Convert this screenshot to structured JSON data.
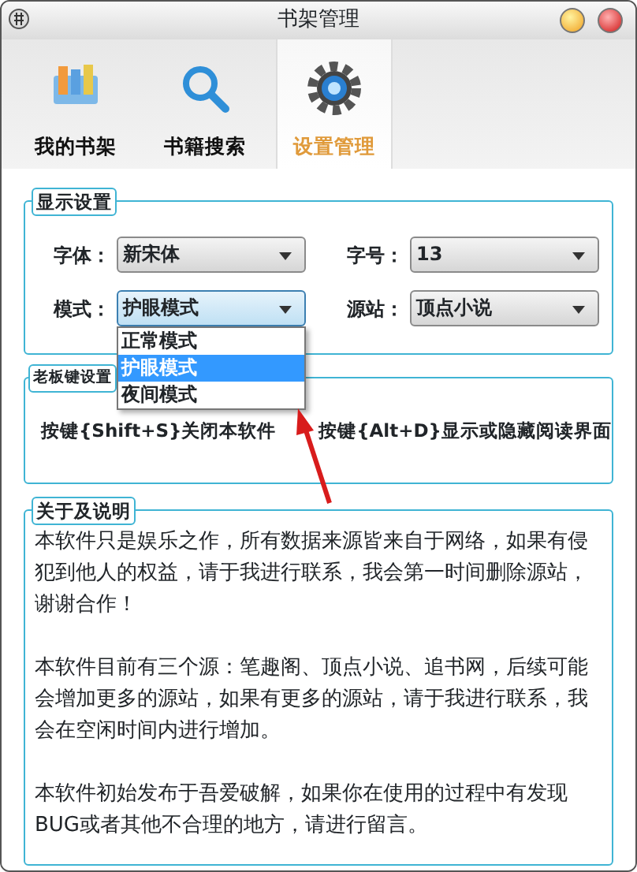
{
  "window": {
    "title": "书架管理"
  },
  "tabs": [
    {
      "label": "我的书架",
      "selected": false
    },
    {
      "label": "书籍搜索",
      "selected": false
    },
    {
      "label": "设置管理",
      "selected": true
    }
  ],
  "display_settings": {
    "title": "显示设置",
    "fields": [
      {
        "label": "字体：",
        "value": "新宋体",
        "expanded": false
      },
      {
        "label": "字号：",
        "value": "13",
        "expanded": false
      },
      {
        "label": "模式：",
        "value": "护眼模式",
        "expanded": true,
        "options": [
          {
            "label": "正常模式",
            "selected": false
          },
          {
            "label": "护眼模式",
            "selected": true
          },
          {
            "label": "夜间模式",
            "selected": false
          }
        ]
      },
      {
        "label": "源站：",
        "value": "顶点小说",
        "expanded": false
      }
    ]
  },
  "hotkey_settings": {
    "title": "老板键设置",
    "items": [
      "按键{Shift+S}关闭本软件",
      "按键{Alt+D}显示或隐藏阅读界面"
    ]
  },
  "about": {
    "title": "关于及说明",
    "paragraphs": [
      "本软件只是娱乐之作，所有数据来源皆来自于网络，如果有侵犯到他人的权益，请于我进行联系，我会第一时间删除源站，谢谢合作！",
      "本软件目前有三个源：笔趣阁、顶点小说、追书网，后续可能会增加更多的源站，如果有更多的源站，请于我进行联系，我会在空闲时间内进行增加。",
      "本软件初始发布于吾爱破解，如果你在使用的过程中有发现BUG或者其他不合理的地方，请进行留言。"
    ]
  }
}
